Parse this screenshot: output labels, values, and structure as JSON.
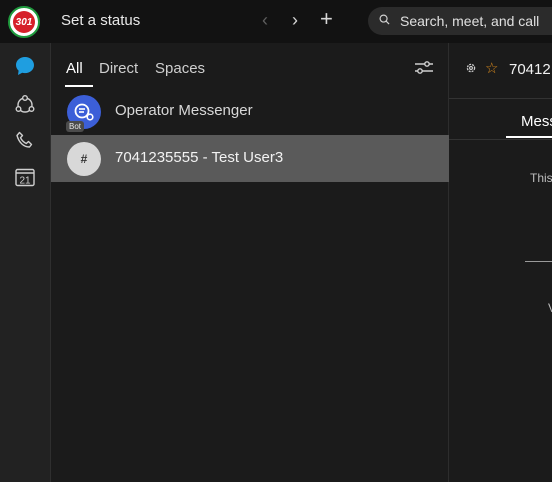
{
  "topbar": {
    "logo_text": "301",
    "status_label": "Set a status",
    "back_glyph": "‹",
    "forward_glyph": "›",
    "add_glyph": "+",
    "search_label": "Search, meet, and call"
  },
  "rail": {
    "items": [
      {
        "icon": "chat-bubble-icon",
        "active": true
      },
      {
        "icon": "teams-icon",
        "active": false
      },
      {
        "icon": "phone-icon",
        "active": false
      },
      {
        "icon": "calendar-icon",
        "label": "21",
        "active": false
      }
    ],
    "accent": "#1f9ee0"
  },
  "list": {
    "tabs": [
      {
        "label": "All",
        "active": true
      },
      {
        "label": "Direct",
        "active": false
      },
      {
        "label": "Spaces",
        "active": false
      }
    ],
    "rows": [
      {
        "label": "Operator Messenger",
        "badge": "Bot",
        "avatar": "bot-icon",
        "selected": false
      },
      {
        "label": "7041235555 - Test User3",
        "avatar_glyph": "#",
        "selected": true
      }
    ]
  },
  "right": {
    "title": "70412",
    "tab_label": "Mess",
    "text1": "This",
    "text2": "V"
  },
  "colors": {
    "background": "#1b1b1b",
    "topbar": "#121212",
    "selected_row": "#5a5a5a",
    "star": "#d98a1d",
    "bot_avatar": "#3c5fd8"
  }
}
